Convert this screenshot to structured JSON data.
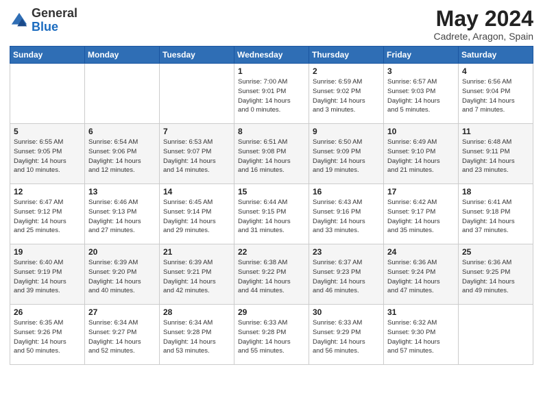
{
  "header": {
    "logo_general": "General",
    "logo_blue": "Blue",
    "month_title": "May 2024",
    "location": "Cadrete, Aragon, Spain"
  },
  "days_of_week": [
    "Sunday",
    "Monday",
    "Tuesday",
    "Wednesday",
    "Thursday",
    "Friday",
    "Saturday"
  ],
  "weeks": [
    [
      {
        "day": "",
        "info": ""
      },
      {
        "day": "",
        "info": ""
      },
      {
        "day": "",
        "info": ""
      },
      {
        "day": "1",
        "info": "Sunrise: 7:00 AM\nSunset: 9:01 PM\nDaylight: 14 hours\nand 0 minutes."
      },
      {
        "day": "2",
        "info": "Sunrise: 6:59 AM\nSunset: 9:02 PM\nDaylight: 14 hours\nand 3 minutes."
      },
      {
        "day": "3",
        "info": "Sunrise: 6:57 AM\nSunset: 9:03 PM\nDaylight: 14 hours\nand 5 minutes."
      },
      {
        "day": "4",
        "info": "Sunrise: 6:56 AM\nSunset: 9:04 PM\nDaylight: 14 hours\nand 7 minutes."
      }
    ],
    [
      {
        "day": "5",
        "info": "Sunrise: 6:55 AM\nSunset: 9:05 PM\nDaylight: 14 hours\nand 10 minutes."
      },
      {
        "day": "6",
        "info": "Sunrise: 6:54 AM\nSunset: 9:06 PM\nDaylight: 14 hours\nand 12 minutes."
      },
      {
        "day": "7",
        "info": "Sunrise: 6:53 AM\nSunset: 9:07 PM\nDaylight: 14 hours\nand 14 minutes."
      },
      {
        "day": "8",
        "info": "Sunrise: 6:51 AM\nSunset: 9:08 PM\nDaylight: 14 hours\nand 16 minutes."
      },
      {
        "day": "9",
        "info": "Sunrise: 6:50 AM\nSunset: 9:09 PM\nDaylight: 14 hours\nand 19 minutes."
      },
      {
        "day": "10",
        "info": "Sunrise: 6:49 AM\nSunset: 9:10 PM\nDaylight: 14 hours\nand 21 minutes."
      },
      {
        "day": "11",
        "info": "Sunrise: 6:48 AM\nSunset: 9:11 PM\nDaylight: 14 hours\nand 23 minutes."
      }
    ],
    [
      {
        "day": "12",
        "info": "Sunrise: 6:47 AM\nSunset: 9:12 PM\nDaylight: 14 hours\nand 25 minutes."
      },
      {
        "day": "13",
        "info": "Sunrise: 6:46 AM\nSunset: 9:13 PM\nDaylight: 14 hours\nand 27 minutes."
      },
      {
        "day": "14",
        "info": "Sunrise: 6:45 AM\nSunset: 9:14 PM\nDaylight: 14 hours\nand 29 minutes."
      },
      {
        "day": "15",
        "info": "Sunrise: 6:44 AM\nSunset: 9:15 PM\nDaylight: 14 hours\nand 31 minutes."
      },
      {
        "day": "16",
        "info": "Sunrise: 6:43 AM\nSunset: 9:16 PM\nDaylight: 14 hours\nand 33 minutes."
      },
      {
        "day": "17",
        "info": "Sunrise: 6:42 AM\nSunset: 9:17 PM\nDaylight: 14 hours\nand 35 minutes."
      },
      {
        "day": "18",
        "info": "Sunrise: 6:41 AM\nSunset: 9:18 PM\nDaylight: 14 hours\nand 37 minutes."
      }
    ],
    [
      {
        "day": "19",
        "info": "Sunrise: 6:40 AM\nSunset: 9:19 PM\nDaylight: 14 hours\nand 39 minutes."
      },
      {
        "day": "20",
        "info": "Sunrise: 6:39 AM\nSunset: 9:20 PM\nDaylight: 14 hours\nand 40 minutes."
      },
      {
        "day": "21",
        "info": "Sunrise: 6:39 AM\nSunset: 9:21 PM\nDaylight: 14 hours\nand 42 minutes."
      },
      {
        "day": "22",
        "info": "Sunrise: 6:38 AM\nSunset: 9:22 PM\nDaylight: 14 hours\nand 44 minutes."
      },
      {
        "day": "23",
        "info": "Sunrise: 6:37 AM\nSunset: 9:23 PM\nDaylight: 14 hours\nand 46 minutes."
      },
      {
        "day": "24",
        "info": "Sunrise: 6:36 AM\nSunset: 9:24 PM\nDaylight: 14 hours\nand 47 minutes."
      },
      {
        "day": "25",
        "info": "Sunrise: 6:36 AM\nSunset: 9:25 PM\nDaylight: 14 hours\nand 49 minutes."
      }
    ],
    [
      {
        "day": "26",
        "info": "Sunrise: 6:35 AM\nSunset: 9:26 PM\nDaylight: 14 hours\nand 50 minutes."
      },
      {
        "day": "27",
        "info": "Sunrise: 6:34 AM\nSunset: 9:27 PM\nDaylight: 14 hours\nand 52 minutes."
      },
      {
        "day": "28",
        "info": "Sunrise: 6:34 AM\nSunset: 9:28 PM\nDaylight: 14 hours\nand 53 minutes."
      },
      {
        "day": "29",
        "info": "Sunrise: 6:33 AM\nSunset: 9:28 PM\nDaylight: 14 hours\nand 55 minutes."
      },
      {
        "day": "30",
        "info": "Sunrise: 6:33 AM\nSunset: 9:29 PM\nDaylight: 14 hours\nand 56 minutes."
      },
      {
        "day": "31",
        "info": "Sunrise: 6:32 AM\nSunset: 9:30 PM\nDaylight: 14 hours\nand 57 minutes."
      },
      {
        "day": "",
        "info": ""
      }
    ]
  ]
}
